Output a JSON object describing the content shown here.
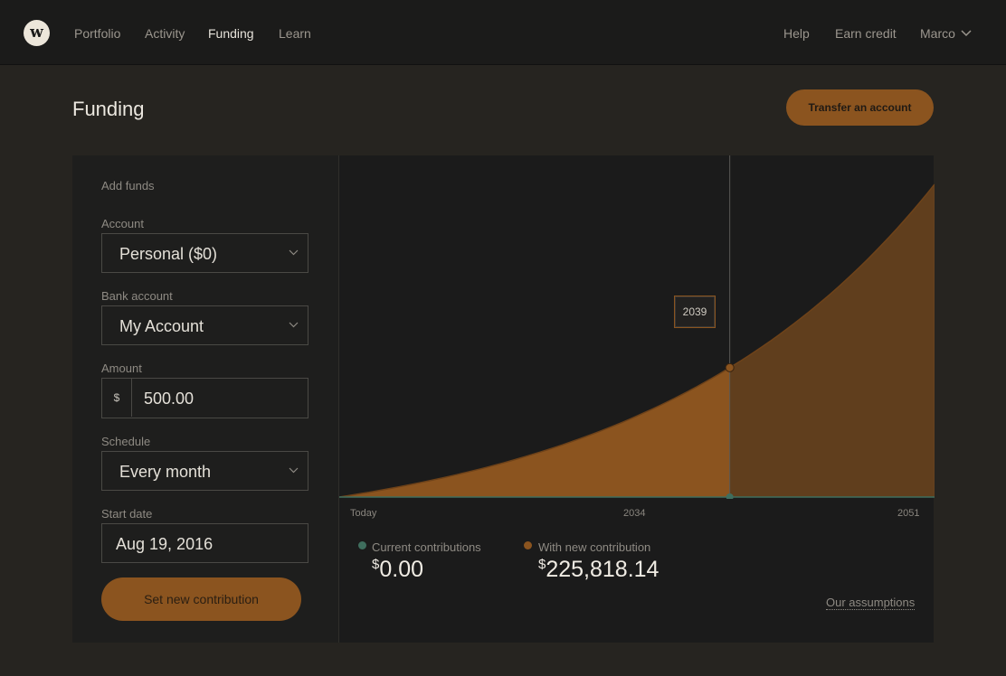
{
  "nav": {
    "logo_letter": "w",
    "items": [
      {
        "label": "Portfolio",
        "active": false
      },
      {
        "label": "Activity",
        "active": false
      },
      {
        "label": "Funding",
        "active": true
      },
      {
        "label": "Learn",
        "active": false
      }
    ],
    "right": {
      "help": "Help",
      "earn_credit": "Earn credit",
      "user": "Marco"
    }
  },
  "page": {
    "title": "Funding",
    "transfer_button": "Transfer an account"
  },
  "form": {
    "section_title": "Add funds",
    "account_label": "Account",
    "account_value": "Personal ($0)",
    "bank_label": "Bank account",
    "bank_value": "My Account",
    "amount_label": "Amount",
    "amount_prefix": "$",
    "amount_value": "500.00",
    "schedule_label": "Schedule",
    "schedule_value": "Every month",
    "start_date_label": "Start date",
    "start_date_value": "Aug 19, 2016",
    "submit_label": "Set new contribution"
  },
  "chart_data": {
    "type": "area",
    "x_tick_labels": [
      "Today",
      "2034",
      "2051"
    ],
    "x_range": [
      2016,
      2051
    ],
    "y_range": [
      0,
      225818.14
    ],
    "hover_year": "2039",
    "hover_fraction": 0.656,
    "series": [
      {
        "name": "Current contributions",
        "final_value": 0,
        "color": "#3f6e5e"
      },
      {
        "name": "With new contribution",
        "final_value": 225818.14,
        "color": "#8b541f"
      }
    ]
  },
  "legend": {
    "current_label": "Current contributions",
    "current_currency": "$",
    "current_value": "0.00",
    "current_color": "#3f6e5e",
    "new_label": "With new contribution",
    "new_currency": "$",
    "new_value": "225,818.14",
    "new_color": "#8b541f"
  },
  "assumptions_link": "Our assumptions"
}
